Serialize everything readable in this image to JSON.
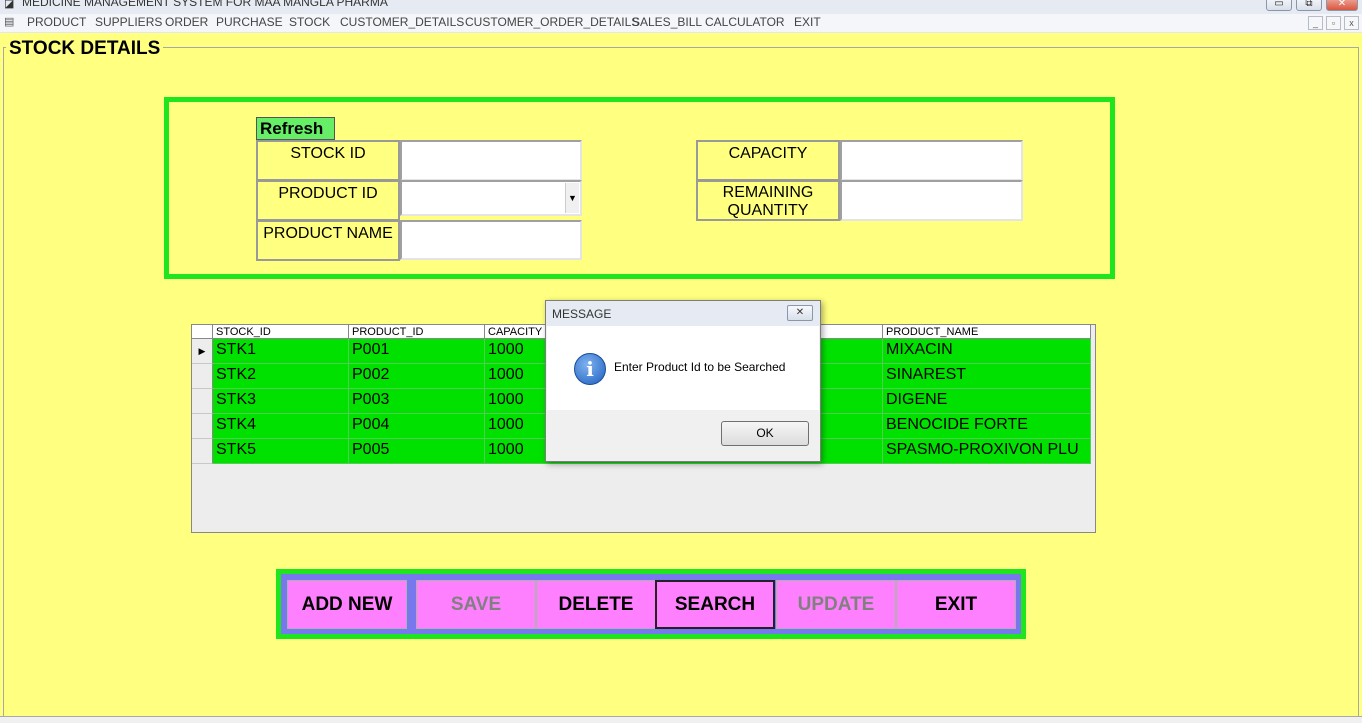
{
  "window": {
    "title": "MEDICINE MANAGEMENT SYSTEM FOR MAA MANGLA PHARMA",
    "minimize": "▭",
    "restore": "⧉",
    "close": "✕"
  },
  "menu": {
    "items": [
      "PRODUCT",
      "SUPPLIERS",
      "ORDER",
      "PURCHASE",
      "STOCK",
      "CUSTOMER_DETAILS",
      "CUSTOMER_ORDER_DETAILS",
      "SALES_BILL",
      "CALCULATOR",
      "EXIT"
    ],
    "mdi_minimize": "_",
    "mdi_restore": "▫",
    "mdi_close": "x"
  },
  "form": {
    "title": "STOCK DETAILS",
    "refresh_label": "Refresh",
    "stock_id_label": "STOCK ID",
    "product_id_label": "PRODUCT ID",
    "product_name_label": "PRODUCT NAME",
    "capacity_label": "CAPACITY",
    "remaining_quantity_label_1": "REMAINING",
    "remaining_quantity_label_2": "QUANTITY",
    "stock_id_value": "",
    "product_id_value": "",
    "product_name_value": "",
    "capacity_value": "",
    "remaining_quantity_value": ""
  },
  "grid": {
    "columns": [
      "STOCK_ID",
      "PRODUCT_ID",
      "CAPACITY",
      "PRODUCT_NAME"
    ],
    "rows": [
      {
        "stock_id": "STK1",
        "product_id": "P001",
        "capacity": "1000",
        "product_name": "MIXACIN"
      },
      {
        "stock_id": "STK2",
        "product_id": "P002",
        "capacity": "1000",
        "product_name": "SINAREST"
      },
      {
        "stock_id": "STK3",
        "product_id": "P003",
        "capacity": "1000",
        "product_name": "DIGENE"
      },
      {
        "stock_id": "STK4",
        "product_id": "P004",
        "capacity": "1000",
        "product_name": "BENOCIDE FORTE"
      },
      {
        "stock_id": "STK5",
        "product_id": "P005",
        "capacity": "1000",
        "product_name": "SPASMO-PROXIVON PLU"
      }
    ],
    "current_row_marker": "▶"
  },
  "message_box": {
    "title": "MESSAGE",
    "text": "Enter Product Id to be Searched",
    "icon": "info-icon",
    "icon_glyph": "i",
    "ok_label": "OK",
    "close_glyph": "✕"
  },
  "actions": {
    "add_new": "ADD NEW",
    "save": "SAVE",
    "delete": "DELETE",
    "search": "SEARCH",
    "update": "UPDATE",
    "exit": "EXIT"
  },
  "colors": {
    "background": "#ffff80",
    "panel_border": "#1ee61e",
    "grid_row": "#00e100",
    "button": "#ff80ff",
    "button_strip": "#7777ee"
  }
}
